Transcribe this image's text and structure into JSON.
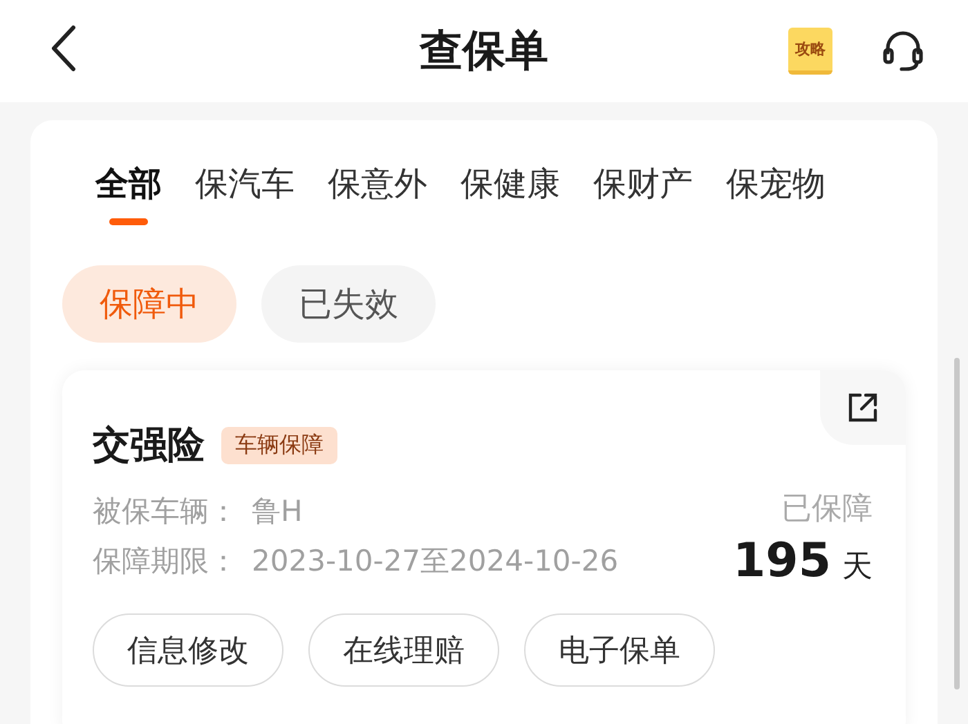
{
  "header": {
    "title": "查保单",
    "guide_label": "攻略"
  },
  "tabs": [
    {
      "label": "全部",
      "selected": true
    },
    {
      "label": "保汽车",
      "selected": false
    },
    {
      "label": "保意外",
      "selected": false
    },
    {
      "label": "保健康",
      "selected": false
    },
    {
      "label": "保财产",
      "selected": false
    },
    {
      "label": "保宠物",
      "selected": false
    }
  ],
  "filters": [
    {
      "label": "保障中",
      "selected": true
    },
    {
      "label": "已失效",
      "selected": false
    }
  ],
  "policy": {
    "name": "交强险",
    "tag": "车辆保障",
    "fields": [
      {
        "label": "被保车辆：",
        "value": "鲁H"
      },
      {
        "label": "保障期限：",
        "value": "2023-10-27至2024-10-26"
      }
    ],
    "covered_label": "已保障",
    "days": "195",
    "days_unit": "天",
    "actions": [
      "信息修改",
      "在线理赔",
      "电子保单"
    ]
  }
}
